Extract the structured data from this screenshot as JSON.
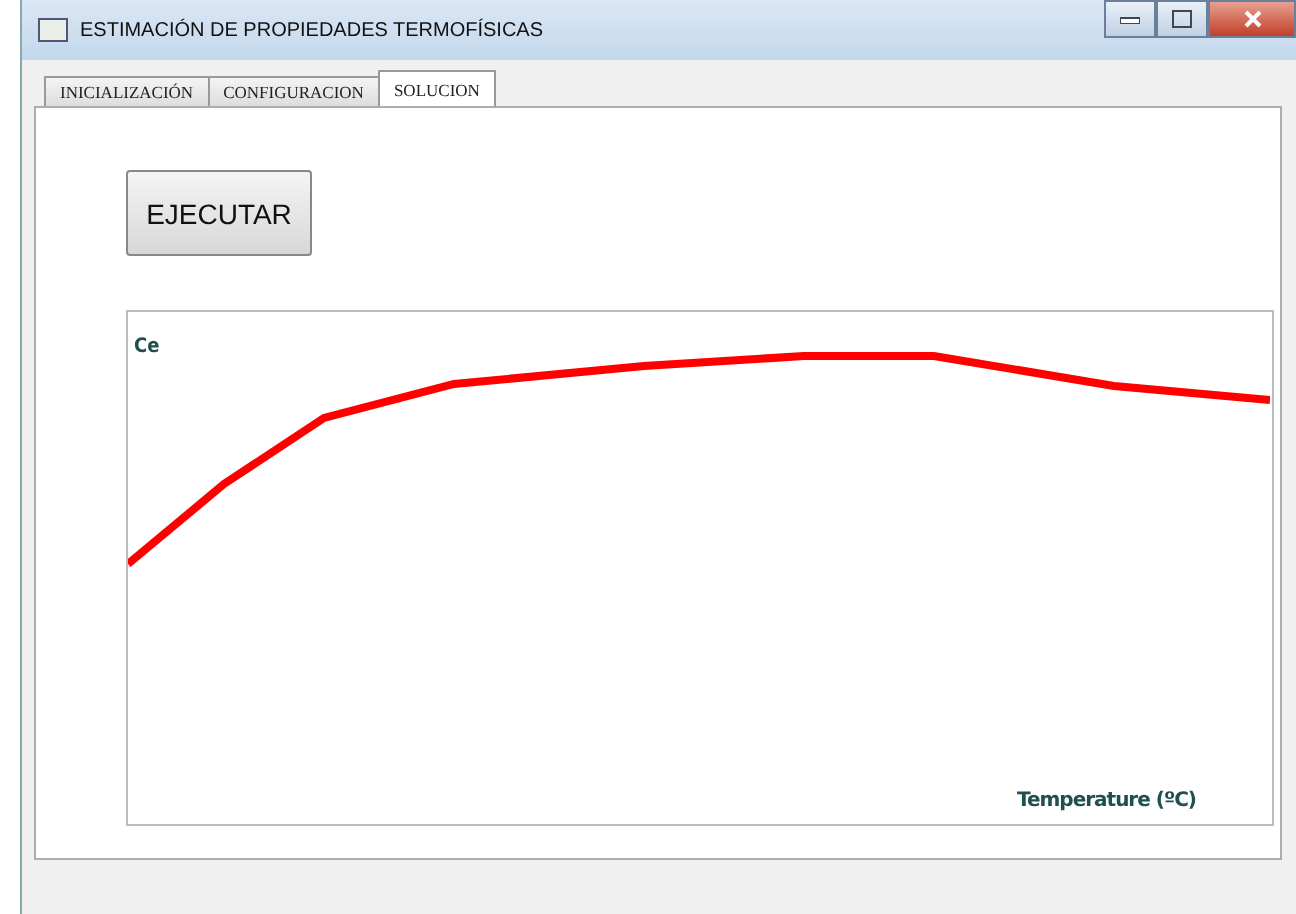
{
  "window": {
    "title": "ESTIMACIÓN DE PROPIEDADES TERMOFÍSICAS"
  },
  "tabs": [
    {
      "label": "INICIALIZACIÓN",
      "selected": false
    },
    {
      "label": "CONFIGURACION",
      "selected": false
    },
    {
      "label": "SOLUCION",
      "selected": true
    }
  ],
  "run_button": "EJECUTAR",
  "chart": {
    "ylabel": "Ce",
    "xlabel": "Temperature (ºC)"
  }
}
